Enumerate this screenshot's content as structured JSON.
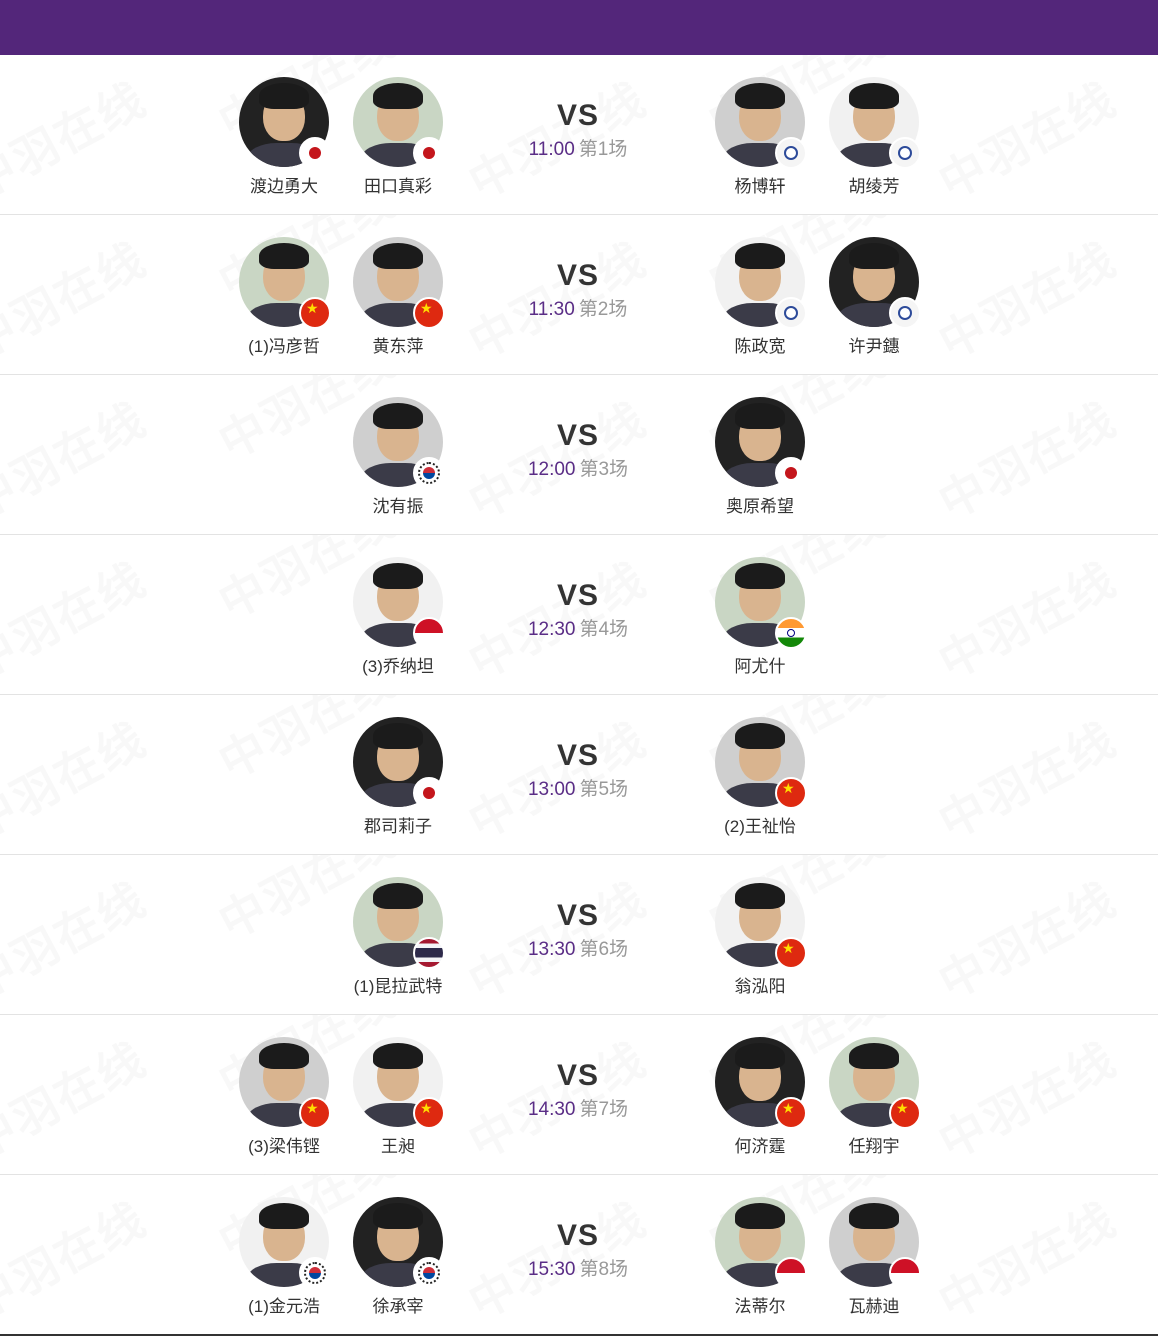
{
  "header": {
    "background": "#53267a"
  },
  "colors": {
    "time": "#5a2d86",
    "order": "#999999",
    "divider": "#e3e3e3"
  },
  "watermark_text": "中羽在线",
  "vs_label": "VS",
  "matches": [
    {
      "time": "11:00",
      "order": "第1场",
      "left": [
        {
          "name": "渡边勇大",
          "flag": "japan-flag-icon"
        },
        {
          "name": "田口真彩",
          "flag": "japan-flag-icon"
        }
      ],
      "right": [
        {
          "name": "杨博轩",
          "flag": "chinese-taipei-flag-icon"
        },
        {
          "name": "胡绫芳",
          "flag": "chinese-taipei-flag-icon"
        }
      ]
    },
    {
      "time": "11:30",
      "order": "第2场",
      "left": [
        {
          "name": "(1)冯彦哲",
          "flag": "china-flag-icon"
        },
        {
          "name": "黄东萍",
          "flag": "china-flag-icon"
        }
      ],
      "right": [
        {
          "name": "陈政宽",
          "flag": "chinese-taipei-flag-icon"
        },
        {
          "name": "许尹鏸",
          "flag": "chinese-taipei-flag-icon"
        }
      ]
    },
    {
      "time": "12:00",
      "order": "第3场",
      "left": [
        {
          "name": "沈有振",
          "flag": "korea-flag-icon"
        }
      ],
      "right": [
        {
          "name": "奥原希望",
          "flag": "japan-flag-icon"
        }
      ]
    },
    {
      "time": "12:30",
      "order": "第4场",
      "left": [
        {
          "name": "(3)乔纳坦",
          "flag": "indonesia-flag-icon"
        }
      ],
      "right": [
        {
          "name": "阿尤什",
          "flag": "india-flag-icon"
        }
      ]
    },
    {
      "time": "13:00",
      "order": "第5场",
      "left": [
        {
          "name": "郡司莉子",
          "flag": "japan-flag-icon"
        }
      ],
      "right": [
        {
          "name": "(2)王祉怡",
          "flag": "china-flag-icon"
        }
      ]
    },
    {
      "time": "13:30",
      "order": "第6场",
      "left": [
        {
          "name": "(1)昆拉武特",
          "flag": "thailand-flag-icon"
        }
      ],
      "right": [
        {
          "name": "翁泓阳",
          "flag": "china-flag-icon"
        }
      ]
    },
    {
      "time": "14:30",
      "order": "第7场",
      "left": [
        {
          "name": "(3)梁伟铿",
          "flag": "china-flag-icon"
        },
        {
          "name": "王昶",
          "flag": "china-flag-icon"
        }
      ],
      "right": [
        {
          "name": "何济霆",
          "flag": "china-flag-icon"
        },
        {
          "name": "任翔宇",
          "flag": "china-flag-icon"
        }
      ]
    },
    {
      "time": "15:30",
      "order": "第8场",
      "left": [
        {
          "name": "(1)金元浩",
          "flag": "korea-flag-icon"
        },
        {
          "name": "徐承宰",
          "flag": "korea-flag-icon"
        }
      ],
      "right": [
        {
          "name": "法蒂尔",
          "flag": "indonesia-flag-icon"
        },
        {
          "name": "瓦赫迪",
          "flag": "indonesia-flag-icon"
        }
      ]
    }
  ]
}
